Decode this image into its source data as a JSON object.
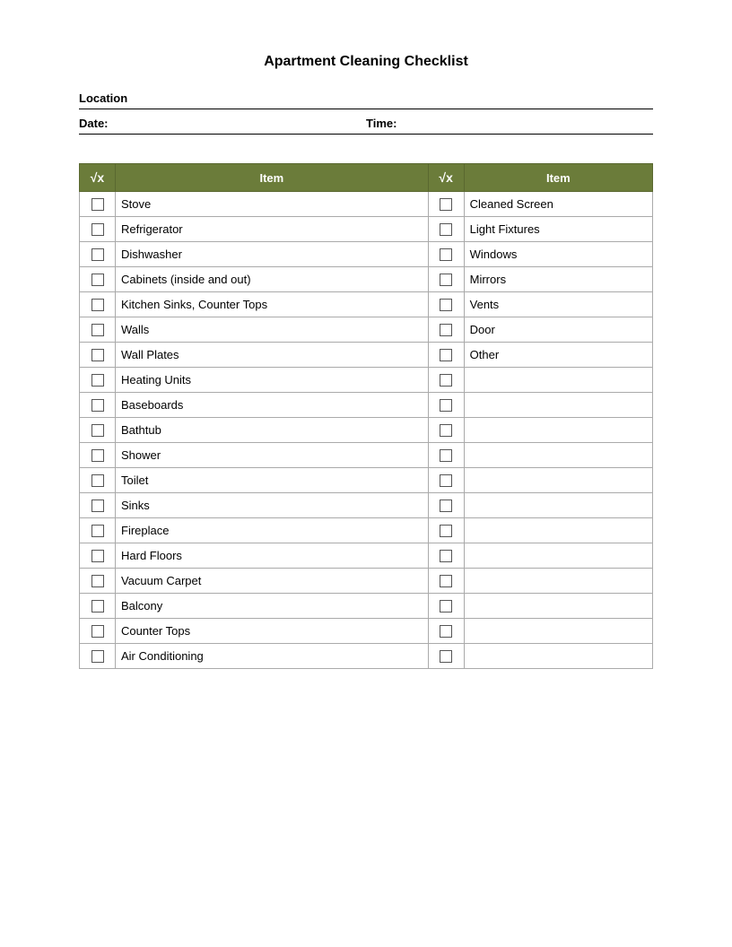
{
  "title": "Apartment Cleaning Checklist",
  "location_label": "Location",
  "date_label": "Date:",
  "time_label": "Time:",
  "header": {
    "check_icon": "√x",
    "item_label": "Item"
  },
  "left_items": [
    "Stove",
    "Refrigerator",
    "Dishwasher",
    "Cabinets (inside and out)",
    "Kitchen Sinks, Counter Tops",
    "Walls",
    "Wall Plates",
    "Heating Units",
    "Baseboards",
    "Bathtub",
    "Shower",
    "Toilet",
    "Sinks",
    "Fireplace",
    "Hard Floors",
    "Vacuum Carpet",
    "Balcony",
    "Counter Tops",
    "Air Conditioning"
  ],
  "right_items": [
    "Cleaned Screen",
    "Light Fixtures",
    "Windows",
    "Mirrors",
    "Vents",
    "Door",
    "Other",
    "",
    "",
    "",
    "",
    "",
    "",
    "",
    "",
    "",
    "",
    "",
    ""
  ]
}
